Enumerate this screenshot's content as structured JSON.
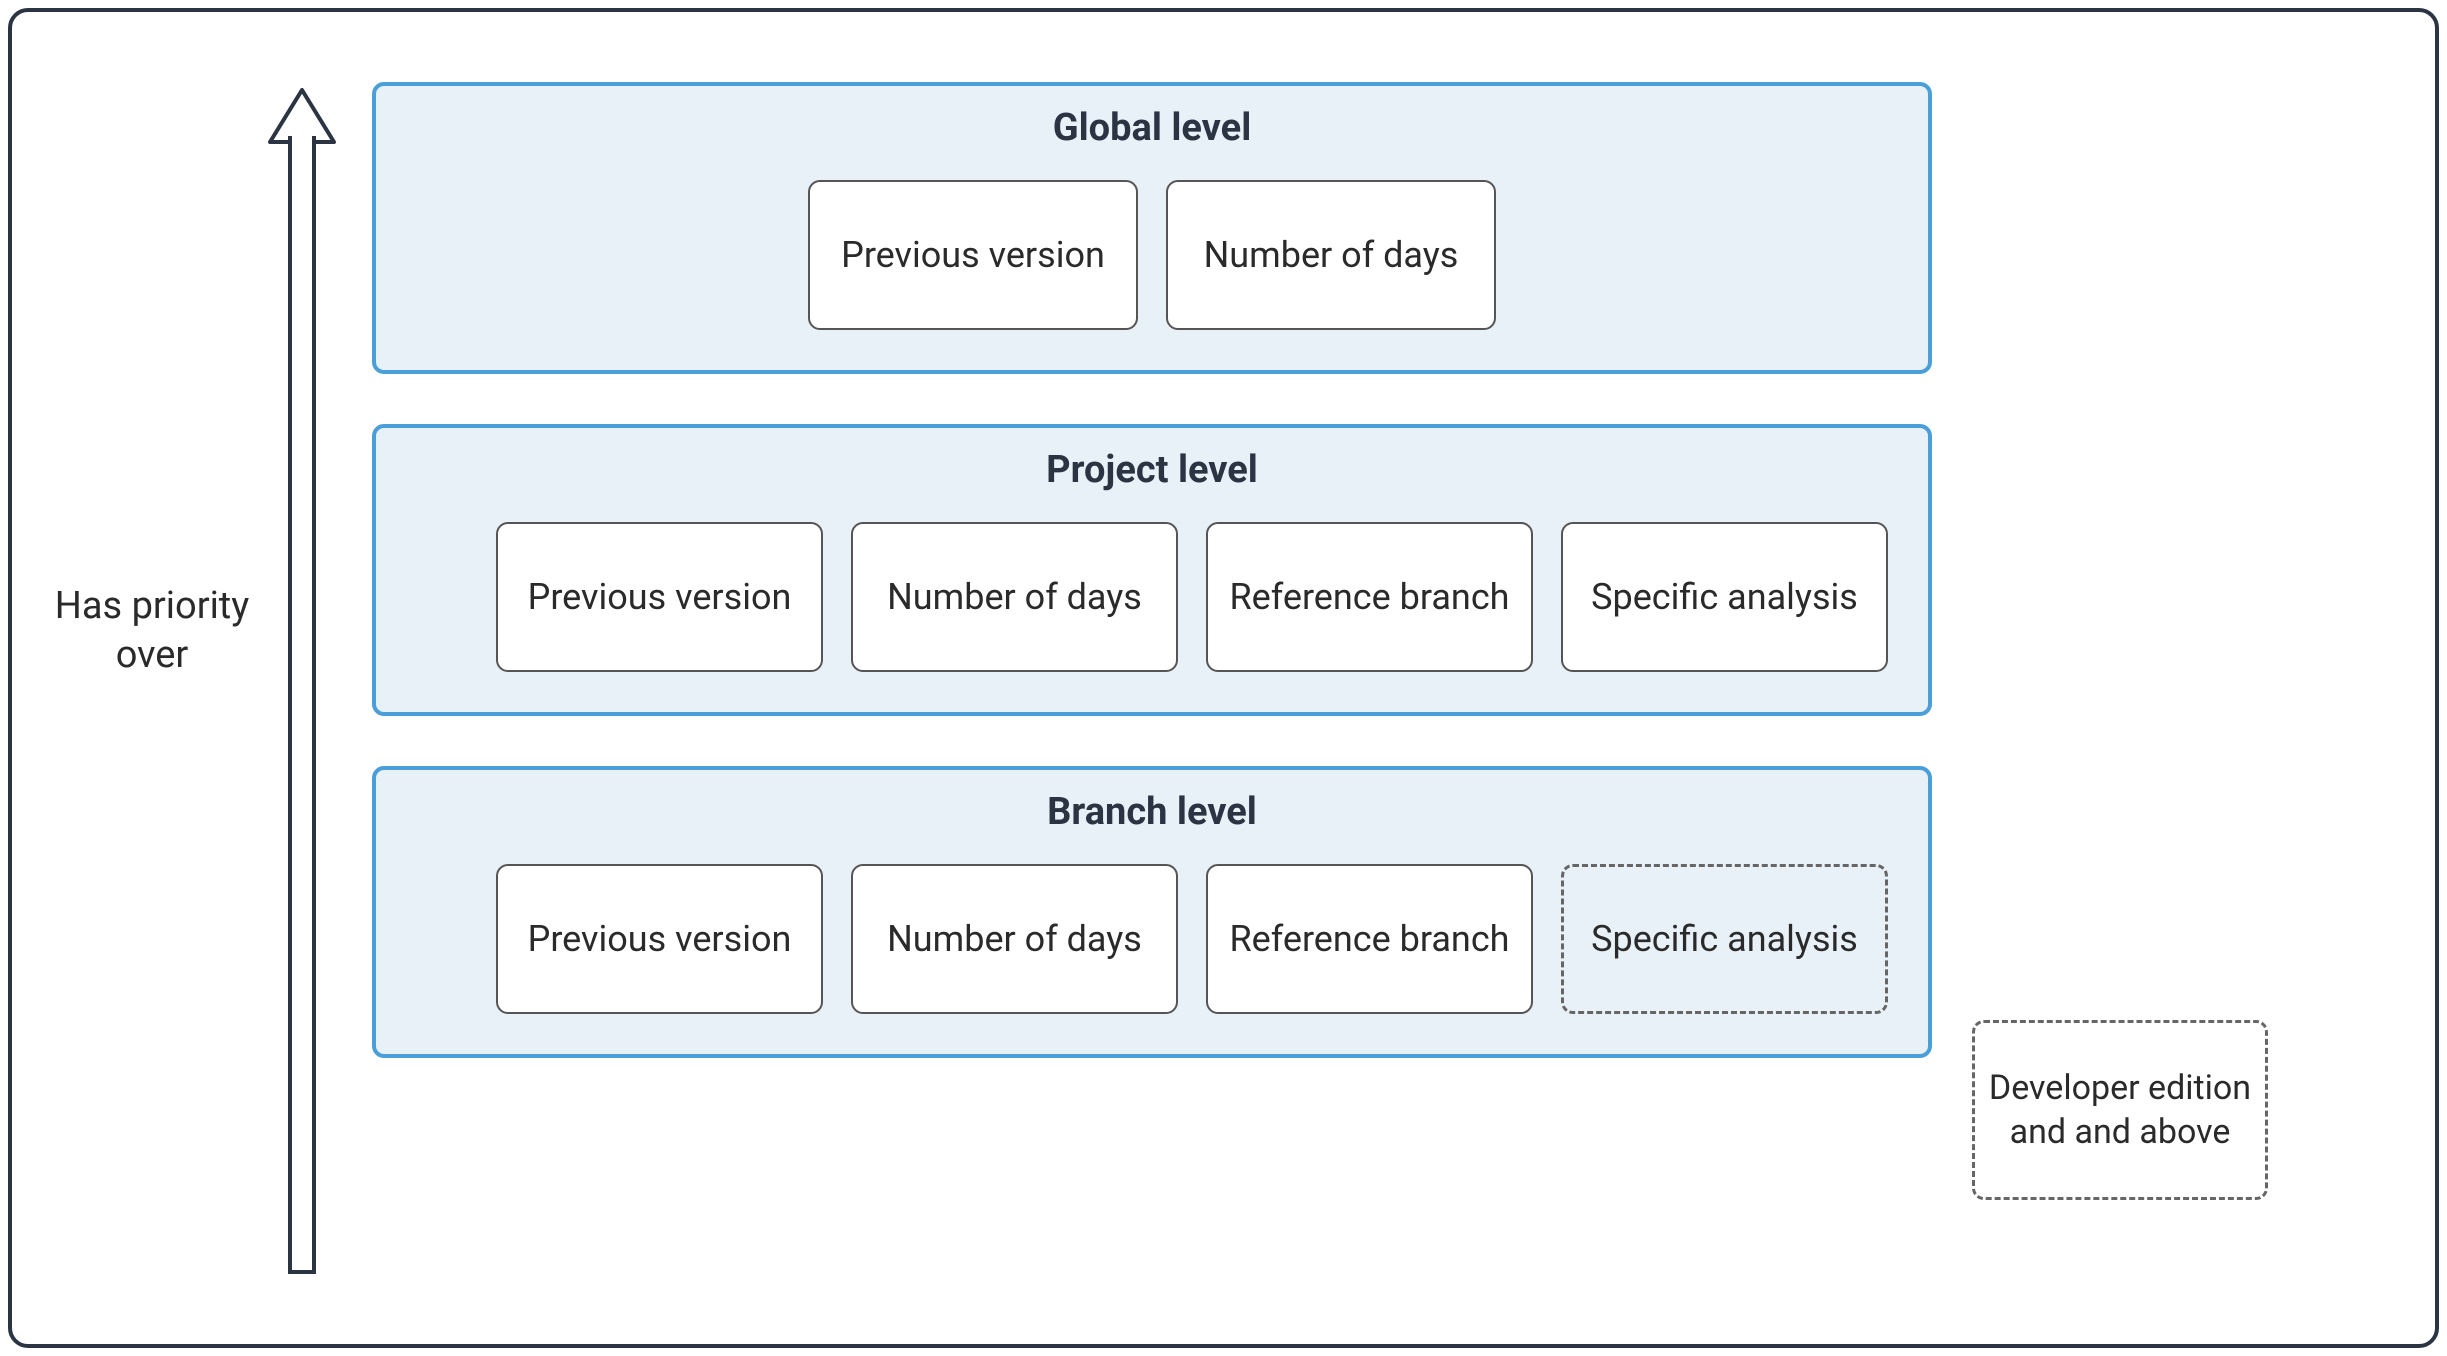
{
  "arrow_label": "Has priority over",
  "levels": [
    {
      "title": "Global level",
      "boxes": [
        {
          "label": "Previous version",
          "dashed": false
        },
        {
          "label": "Number of days",
          "dashed": false
        }
      ]
    },
    {
      "title": "Project level",
      "boxes": [
        {
          "label": "Previous version",
          "dashed": false
        },
        {
          "label": "Number of days",
          "dashed": false
        },
        {
          "label": "Reference branch",
          "dashed": false
        },
        {
          "label": "Specific analysis",
          "dashed": false
        }
      ]
    },
    {
      "title": "Branch level",
      "boxes": [
        {
          "label": "Previous version",
          "dashed": false
        },
        {
          "label": "Number of days",
          "dashed": false
        },
        {
          "label": "Reference branch",
          "dashed": false
        },
        {
          "label": "Specific analysis",
          "dashed": true
        }
      ]
    }
  ],
  "legend": "Developer edition and and above"
}
